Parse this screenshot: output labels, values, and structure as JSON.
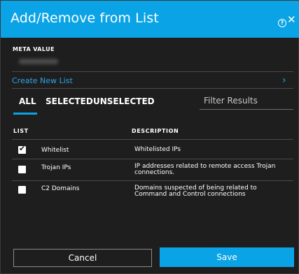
{
  "dialog": {
    "title": "Add/Remove from List",
    "help_icon": "help-circle-icon",
    "close_icon": "close-icon"
  },
  "meta": {
    "label": "META VALUE",
    "value_obscured": true
  },
  "create_link": {
    "label": "Create New List",
    "icon": "chevron-right-icon"
  },
  "tabs": [
    {
      "label": "ALL",
      "active": true
    },
    {
      "label": "SELECTED",
      "active": false
    },
    {
      "label": "UNSELECTED",
      "active": false
    }
  ],
  "filter": {
    "placeholder": "Filter Results",
    "value": ""
  },
  "table": {
    "headers": {
      "list": "LIST",
      "description": "DESCRIPTION"
    },
    "rows": [
      {
        "name": "Whitelist",
        "description": "Whitelisted IPs",
        "checked": true
      },
      {
        "name": "Trojan IPs",
        "description": "IP addresses related to remote access Trojan connections.",
        "checked": false
      },
      {
        "name": "C2 Domains",
        "description": "Domains suspected of being related to Command and Control connections",
        "checked": false
      }
    ]
  },
  "buttons": {
    "cancel": "Cancel",
    "save": "Save"
  },
  "colors": {
    "accent": "#0aa3e6",
    "background": "#1e1e1e",
    "link": "#2aa7e8"
  }
}
